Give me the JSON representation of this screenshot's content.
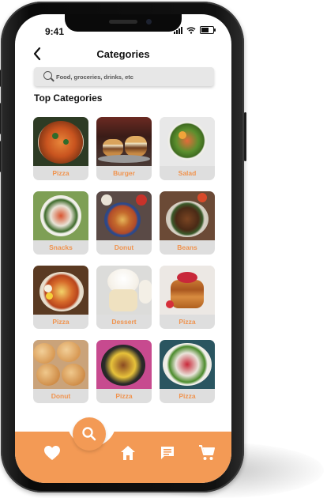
{
  "status_bar": {
    "time": "9:41"
  },
  "header": {
    "title": "Categories"
  },
  "search": {
    "placeholder": "Food, groceries, drinks, etc"
  },
  "section": {
    "title": "Top Categories"
  },
  "categories": [
    {
      "label": "Pizza"
    },
    {
      "label": "Burger"
    },
    {
      "label": "Salad"
    },
    {
      "label": "Snacks"
    },
    {
      "label": "Donut"
    },
    {
      "label": "Beans"
    },
    {
      "label": "Pizza"
    },
    {
      "label": "Dessert"
    },
    {
      "label": "Pizza"
    },
    {
      "label": "Donut"
    },
    {
      "label": "Pizza"
    },
    {
      "label": "Pizza"
    }
  ],
  "bottom_nav": {
    "items": [
      "heart-icon",
      "search-icon",
      "home-icon",
      "chat-icon",
      "cart-icon"
    ],
    "active": "search-icon"
  },
  "colors": {
    "accent": "#f39a55",
    "label": "#f0934e",
    "card_bg": "#dedede",
    "search_bg": "#e7e7e7"
  }
}
